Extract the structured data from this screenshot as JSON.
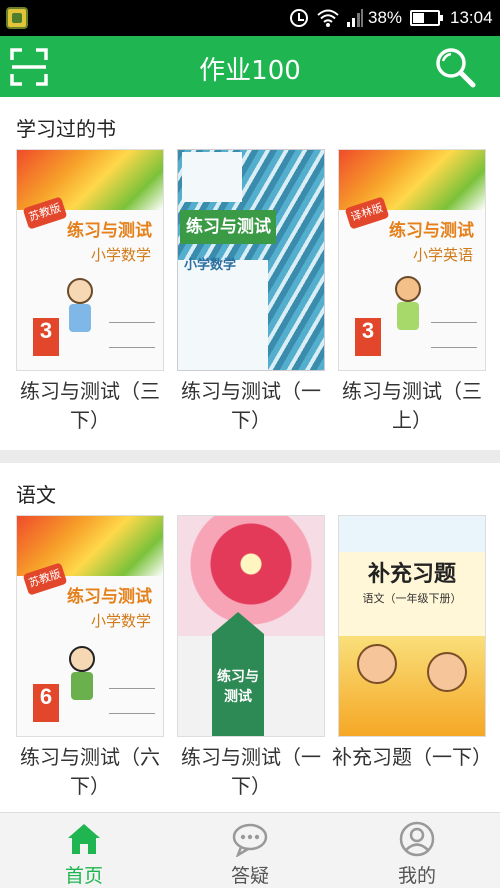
{
  "status_bar": {
    "battery_percent": "38%",
    "time": "13:04"
  },
  "header": {
    "title": "作业100",
    "scan_icon": "scan-icon",
    "search_icon": "search-icon",
    "accent_color": "#1fb550"
  },
  "sections": [
    {
      "title": "学习过的书",
      "books": [
        {
          "name": "练习与测试（三下）",
          "cover": {
            "badge": "苏教版",
            "title": "练习与测试",
            "subtitle": "小学数学",
            "grade": "3"
          }
        },
        {
          "name": "练习与测试（一下）",
          "cover": {
            "title": "练习与测试",
            "subtitle": "小学数学"
          }
        },
        {
          "name": "练习与测试（三上）",
          "cover": {
            "badge": "译林版",
            "title": "练习与测试",
            "subtitle": "小学英语",
            "grade": "3"
          }
        }
      ]
    },
    {
      "title": "语文",
      "books": [
        {
          "name": "练习与测试（六下）",
          "cover": {
            "badge": "苏教版",
            "title": "练习与测试",
            "subtitle": "小学数学",
            "grade": "6"
          }
        },
        {
          "name": "练习与测试（一下）",
          "cover": {
            "title": "练习与测试"
          }
        },
        {
          "name": "补充习题（一下）",
          "cover": {
            "title": "补充习题",
            "subtitle": "语文（一年级下册）"
          }
        }
      ]
    }
  ],
  "bottom_nav": [
    {
      "label": "首页",
      "icon": "home-icon",
      "active": true
    },
    {
      "label": "答疑",
      "icon": "chat-bubble-icon",
      "active": false
    },
    {
      "label": "我的",
      "icon": "user-icon",
      "active": false
    }
  ]
}
